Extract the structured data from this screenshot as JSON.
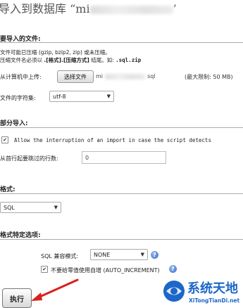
{
  "title": {
    "prefix": "导入到数据库 “mi",
    "suffix": "’"
  },
  "file_section": {
    "heading": "要导入的文件:",
    "note1": "文件可能已压缩 (gzip, bzip2, zip) 或未压缩。",
    "note2_prefix": "压缩文件名必须以",
    "note2_format": ".[格式].[压缩方式]",
    "note2_mid": "结尾。如:",
    "note2_example": ".sql.zip",
    "upload_label": "从计算机中上传:",
    "choose_button": "选择文件",
    "file_name_start": "mi",
    "file_name_end": "sql",
    "max_limit": "(最大限制: 50 MB)",
    "charset_label": "文件的字符集:",
    "charset_value": "utf-8"
  },
  "partial_section": {
    "heading": "部分导入:",
    "allow_interrupt_label": "Allow the interruption of an import in case the script detects",
    "allow_interrupt_checked": true,
    "skip_label": "从首行起要跳过的行数:",
    "skip_value": "0"
  },
  "format_section": {
    "heading": "格式:",
    "format_value": "SQL"
  },
  "format_options_section": {
    "heading": "格式特定选项:",
    "compat_label": "SQL 兼容模式:",
    "compat_value": "NONE",
    "auto_increment_label": "不要给零值使用自增 (AUTO_INCREMENT)",
    "auto_increment_checked": true
  },
  "actions": {
    "execute_button": "执行"
  },
  "watermark": {
    "brand_cn": "系统天地",
    "brand_url": "XiTongTianDi.net"
  },
  "colors": {
    "arrow": "#d9201c",
    "help_icon": "#3b6fc4",
    "logo_blue": "#1c67c8"
  }
}
